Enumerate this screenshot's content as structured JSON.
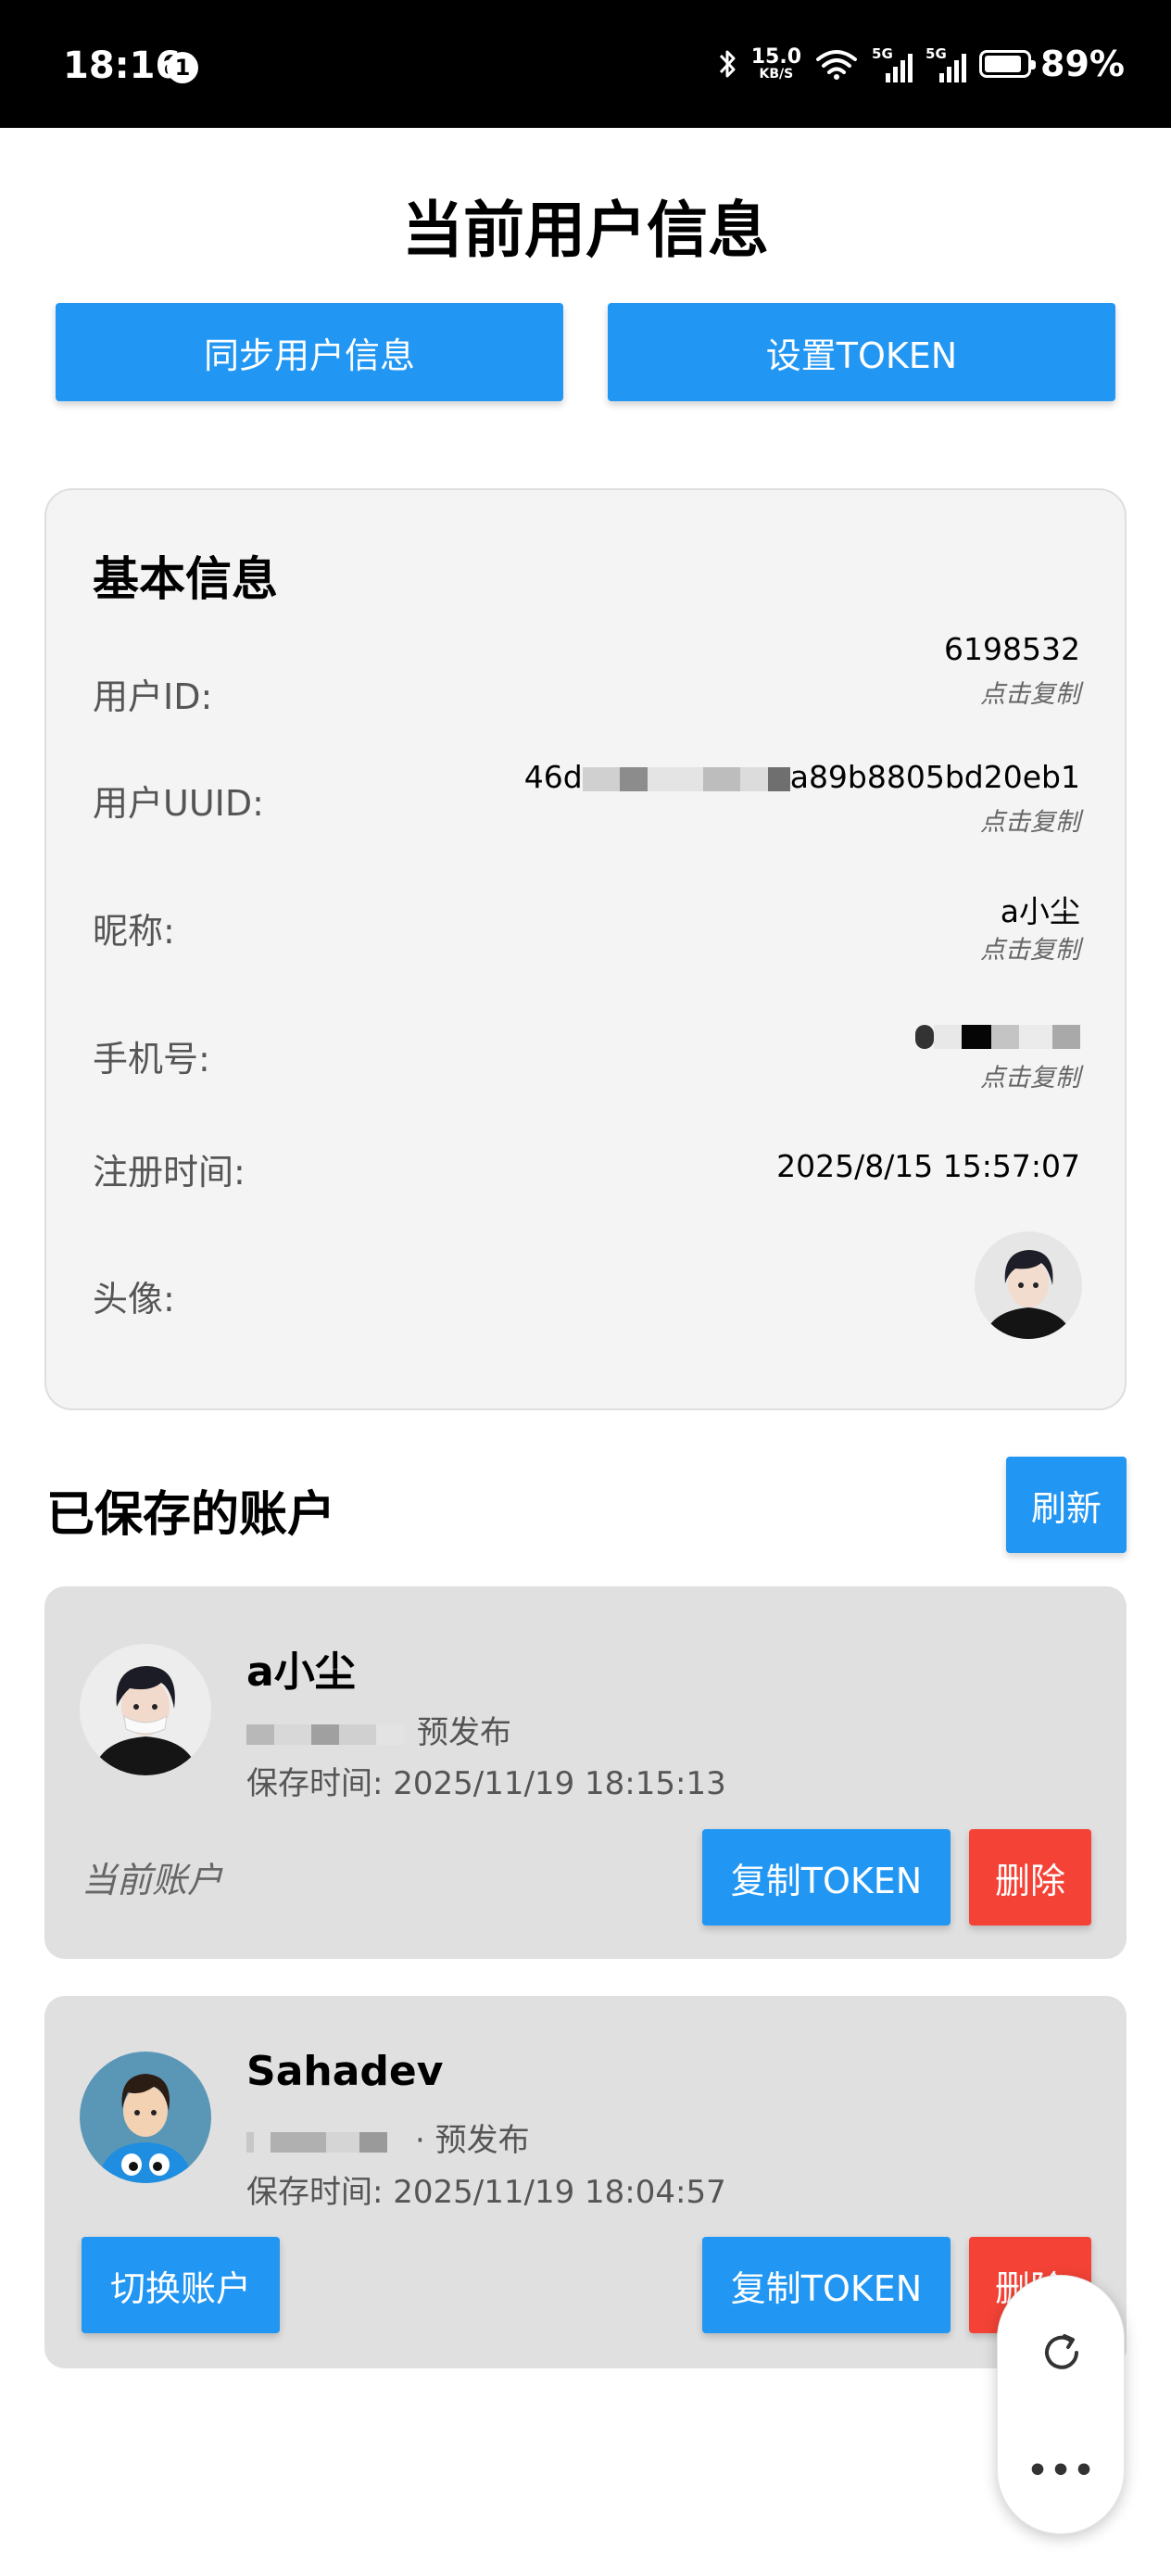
{
  "status_bar": {
    "time": "18:16",
    "notification_badge": "1",
    "net_speed_value": "15.0",
    "net_speed_unit": "KB/S",
    "sim1_tag": "5G",
    "sim2_tag": "5G",
    "battery_percent": "89%",
    "battery_level": 0.89
  },
  "header": {
    "title": "当前用户信息",
    "sync_button": "同步用户信息",
    "token_button": "设置TOKEN"
  },
  "basic_info": {
    "title": "基本信息",
    "copy_hint": "点击复制",
    "user_id_label": "用户ID:",
    "user_id_value": "6198532",
    "uuid_label": "用户UUID:",
    "uuid_prefix": "46d",
    "uuid_suffix": "a89b8805bd20eb1",
    "nickname_label": "昵称:",
    "nickname_value": "a小尘",
    "phone_label": "手机号:",
    "register_label": "注册时间:",
    "register_value": "2025/8/15 15:57:07",
    "avatar_label": "头像:"
  },
  "saved_accounts": {
    "title": "已保存的账户",
    "refresh_button": "刷新",
    "accounts": [
      {
        "name": "a小尘",
        "env": "预发布",
        "saved_time": "保存时间: 2025/11/19 18:15:13",
        "status": "当前账户",
        "copy_button": "复制TOKEN",
        "delete_button": "删除"
      },
      {
        "name": "Sahadev",
        "env": "· 预发布",
        "saved_time": "保存时间: 2025/11/19 18:04:57",
        "switch_button": "切换账户",
        "copy_button": "复制TOKEN",
        "delete_button": "删除"
      }
    ]
  },
  "floating_widget": {
    "more_glyph": "•••"
  },
  "colors": {
    "primary": "#2196f3",
    "danger": "#f44336",
    "card_bg": "#f4f4f5",
    "account_bg": "#e0e0e0"
  }
}
